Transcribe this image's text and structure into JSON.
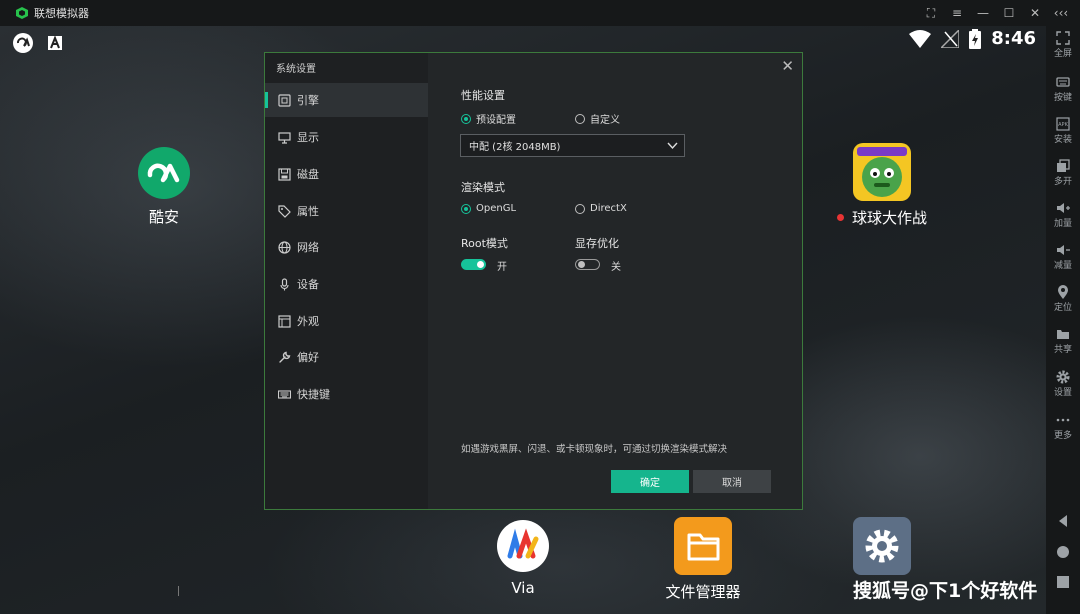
{
  "window": {
    "title": "联想模拟器",
    "controls": [
      "screenshot-icon",
      "menu-icon",
      "minimize-icon",
      "maximize-icon",
      "close-icon",
      "collapse-icon"
    ]
  },
  "statusbar": {
    "time": "8:46"
  },
  "desktop": {
    "apps": [
      {
        "name": "酷安",
        "icon": "coolapk-icon"
      },
      {
        "name": "球球大作战",
        "icon": "game-icon"
      },
      {
        "name": "Via",
        "icon": "via-icon"
      },
      {
        "name": "文件管理器",
        "icon": "folder-icon"
      },
      {
        "name": "",
        "icon": "settings-icon"
      }
    ]
  },
  "sidebar": {
    "tools": [
      {
        "label": "全屏",
        "icon": "fullscreen-icon"
      },
      {
        "label": "按键",
        "icon": "keyboard-icon"
      },
      {
        "label": "安装",
        "icon": "apk-icon"
      },
      {
        "label": "多开",
        "icon": "multi-instance-icon"
      },
      {
        "label": "加量",
        "icon": "volume-up-icon"
      },
      {
        "label": "减量",
        "icon": "volume-down-icon"
      },
      {
        "label": "定位",
        "icon": "location-icon"
      },
      {
        "label": "共享",
        "icon": "share-folder-icon"
      },
      {
        "label": "设置",
        "icon": "gear-icon"
      },
      {
        "label": "更多",
        "icon": "more-icon"
      }
    ]
  },
  "dialog": {
    "title": "系统设置",
    "nav": [
      {
        "label": "引擎",
        "icon": "engine-icon",
        "active": true
      },
      {
        "label": "显示",
        "icon": "display-icon"
      },
      {
        "label": "磁盘",
        "icon": "disk-icon"
      },
      {
        "label": "属性",
        "icon": "tag-icon"
      },
      {
        "label": "网络",
        "icon": "globe-icon"
      },
      {
        "label": "设备",
        "icon": "mic-icon"
      },
      {
        "label": "外观",
        "icon": "window-icon"
      },
      {
        "label": "偏好",
        "icon": "wrench-icon"
      },
      {
        "label": "快捷键",
        "icon": "keyboard-icon"
      }
    ],
    "performance": {
      "title": "性能设置",
      "preset_label": "预设配置",
      "custom_label": "自定义",
      "selected": "preset",
      "profile_value": "中配 (2核 2048MB)"
    },
    "render": {
      "title": "渲染模式",
      "opengl_label": "OpenGL",
      "directx_label": "DirectX",
      "selected": "opengl"
    },
    "root": {
      "title": "Root模式",
      "state_label": "开",
      "on": true
    },
    "vram": {
      "title": "显存优化",
      "state_label": "关",
      "on": false
    },
    "hint": "如遇游戏黑屏、闪退、或卡顿现象时，可通过切换渲染模式解决",
    "ok_label": "确定",
    "cancel_label": "取消"
  },
  "watermark": "搜狐号@下1个好软件",
  "colors": {
    "accent": "#16c39a",
    "dialog_bg": "#232628",
    "nav_bg": "#1e2022",
    "border": "#3c7a3c"
  }
}
